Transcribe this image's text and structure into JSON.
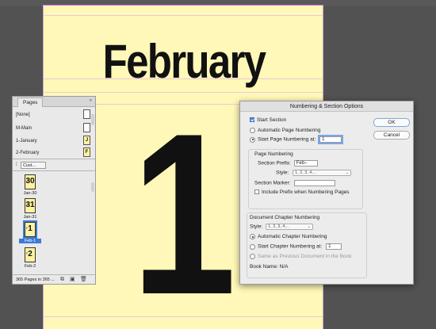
{
  "document": {
    "heading": "February",
    "page_number": "1"
  },
  "pages_panel": {
    "tab_label": "Pages",
    "collapse_glyph": "»",
    "masters": [
      {
        "label": "[None]",
        "thumb": ""
      },
      {
        "label": "M-Main",
        "thumb": ""
      },
      {
        "label": "1-January",
        "thumb": "J"
      },
      {
        "label": "2-February",
        "thumb": "F"
      }
    ],
    "view_select": "Cust...",
    "pages": [
      {
        "label": "Jan-30",
        "number": "30",
        "prefix": "J"
      },
      {
        "label": "Jan-31",
        "number": "31",
        "prefix": "J"
      },
      {
        "label": "Feb-1",
        "number": "1",
        "prefix": "F"
      },
      {
        "label": "Feb-2",
        "number": "2",
        "prefix": "F"
      }
    ],
    "footer": "365 Pages in 365 ..."
  },
  "dialog": {
    "title": "Numbering & Section Options",
    "ok_label": "OK",
    "cancel_label": "Cancel",
    "start_section_label": "Start Section",
    "auto_numbering_label": "Automatic Page Numbering",
    "start_at_label": "Start Page Numbering at:",
    "start_at_value": "1",
    "page_numbering_group": "Page Numbering",
    "section_prefix_label": "Section Prefix:",
    "section_prefix_value": "Feb–",
    "style_label": "Style:",
    "style_value": "1, 2, 3, 4...",
    "section_marker_label": "Section Marker:",
    "section_marker_value": "",
    "include_prefix_label": "Include Prefix when Numbering Pages",
    "chapter_group": "Document Chapter Numbering",
    "chapter_style_label": "Style:",
    "chapter_style_value": "1, 2, 3, 4...",
    "auto_chapter_label": "Automatic Chapter Numbering",
    "start_chapter_label": "Start Chapter Numbering at:",
    "start_chapter_value": "1",
    "same_as_previous_label": "Same as Previous Document in the Book",
    "book_name_label": "Book Name: N/A"
  },
  "colors": {
    "page_fill": "#fff8b8",
    "selection": "#3b7bd6"
  }
}
